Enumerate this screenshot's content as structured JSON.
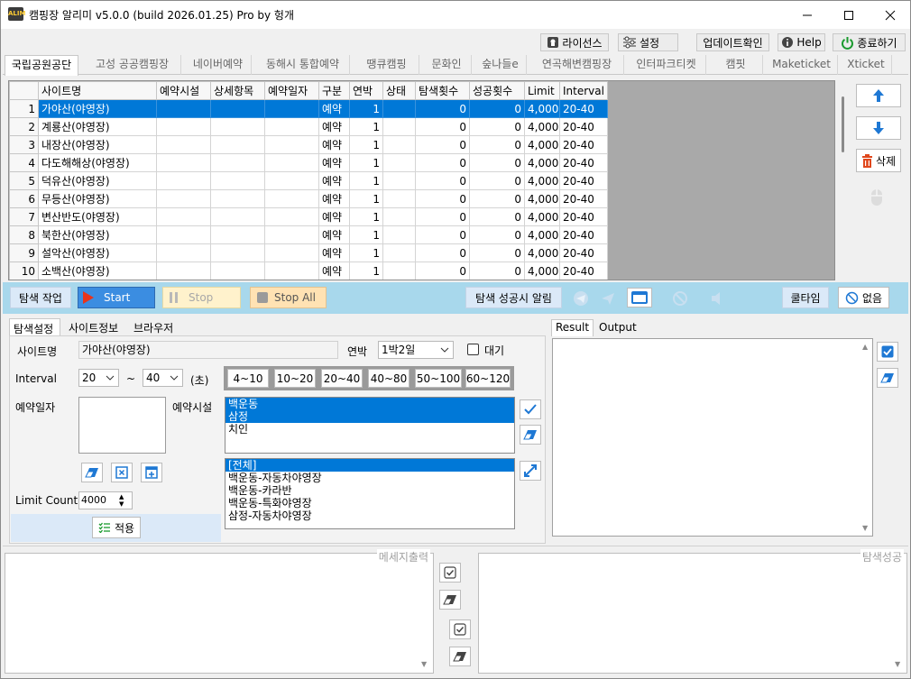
{
  "window": {
    "title": "캠핑장 알리미 v5.0.0 (build 2026.01.25) Pro by 헝개",
    "icon_text": "ALIM"
  },
  "toolbar": {
    "license": "라이선스",
    "settings": "설정",
    "update": "업데이트확인",
    "help": "Help",
    "exit": "종료하기"
  },
  "tabs": [
    "국립공원공단",
    "고성 공공캠핑장",
    "네이버예약",
    "동해시 통합예약",
    "땡큐캠핑",
    "문화인",
    "숲나들e",
    "연곡해변캠핑장",
    "인터파크티켓",
    "캠핏",
    "Maketicket",
    "Xticket"
  ],
  "grid": {
    "columns": [
      "사이트명",
      "예약시설",
      "상세항목",
      "예약일자",
      "구분",
      "연박",
      "상태",
      "탐색횟수",
      "성공횟수",
      "Limit",
      "Interval"
    ],
    "rows": [
      {
        "no": "1",
        "site": "가야산(야영장)",
        "facility": "",
        "detail": "",
        "date": "",
        "type": "예약",
        "nights": "1",
        "status": "",
        "search": "0",
        "success": "0",
        "limit": "4,000",
        "interval": "20-40"
      },
      {
        "no": "2",
        "site": "계룡산(야영장)",
        "facility": "",
        "detail": "",
        "date": "",
        "type": "예약",
        "nights": "1",
        "status": "",
        "search": "0",
        "success": "0",
        "limit": "4,000",
        "interval": "20-40"
      },
      {
        "no": "3",
        "site": "내장산(야영장)",
        "facility": "",
        "detail": "",
        "date": "",
        "type": "예약",
        "nights": "1",
        "status": "",
        "search": "0",
        "success": "0",
        "limit": "4,000",
        "interval": "20-40"
      },
      {
        "no": "4",
        "site": "다도해해상(야영장)",
        "facility": "",
        "detail": "",
        "date": "",
        "type": "예약",
        "nights": "1",
        "status": "",
        "search": "0",
        "success": "0",
        "limit": "4,000",
        "interval": "20-40"
      },
      {
        "no": "5",
        "site": "덕유산(야영장)",
        "facility": "",
        "detail": "",
        "date": "",
        "type": "예약",
        "nights": "1",
        "status": "",
        "search": "0",
        "success": "0",
        "limit": "4,000",
        "interval": "20-40"
      },
      {
        "no": "6",
        "site": "무등산(야영장)",
        "facility": "",
        "detail": "",
        "date": "",
        "type": "예약",
        "nights": "1",
        "status": "",
        "search": "0",
        "success": "0",
        "limit": "4,000",
        "interval": "20-40"
      },
      {
        "no": "7",
        "site": "변산반도(야영장)",
        "facility": "",
        "detail": "",
        "date": "",
        "type": "예약",
        "nights": "1",
        "status": "",
        "search": "0",
        "success": "0",
        "limit": "4,000",
        "interval": "20-40"
      },
      {
        "no": "8",
        "site": "북한산(야영장)",
        "facility": "",
        "detail": "",
        "date": "",
        "type": "예약",
        "nights": "1",
        "status": "",
        "search": "0",
        "success": "0",
        "limit": "4,000",
        "interval": "20-40"
      },
      {
        "no": "9",
        "site": "설악산(야영장)",
        "facility": "",
        "detail": "",
        "date": "",
        "type": "예약",
        "nights": "1",
        "status": "",
        "search": "0",
        "success": "0",
        "limit": "4,000",
        "interval": "20-40"
      },
      {
        "no": "10",
        "site": "소백산(야영장)",
        "facility": "",
        "detail": "",
        "date": "",
        "type": "예약",
        "nights": "1",
        "status": "",
        "search": "0",
        "success": "0",
        "limit": "4,000",
        "interval": "20-40"
      }
    ]
  },
  "side": {
    "delete": "삭제"
  },
  "control": {
    "search_work": "탐색 작업",
    "start": "Start",
    "stop": "Stop",
    "stop_all": "Stop All",
    "success_alert": "탐색 성공시 알림",
    "cooltime": "쿨타임",
    "none": "없음"
  },
  "subtabs": [
    "탐색설정",
    "사이트정보",
    "브라우저"
  ],
  "settings": {
    "site_label": "사이트명",
    "site_value": "가야산(야영장)",
    "nights_label": "연박",
    "nights_value": "1박2일",
    "wait_label": "대기",
    "interval_label": "Interval",
    "interval_min": "20",
    "interval_sep": "~",
    "interval_max": "40",
    "interval_unit": "(초)",
    "ranges": [
      "4~10",
      "10~20",
      "20~40",
      "40~80",
      "50~100",
      "60~120"
    ],
    "date_label": "예약일자",
    "facility_label": "예약시설",
    "facilities": [
      {
        "name": "백운동",
        "selected": true
      },
      {
        "name": "삼정",
        "selected": true
      },
      {
        "name": "치인",
        "selected": false
      }
    ],
    "details": [
      {
        "name": "[전체]",
        "selected": true
      },
      {
        "name": "백운동-자동차야영장",
        "selected": false
      },
      {
        "name": "백운동-카라반",
        "selected": false
      },
      {
        "name": "백운동-특화야영장",
        "selected": false
      },
      {
        "name": "삼정-자동차야영장",
        "selected": false
      }
    ],
    "limit_label": "Limit Count",
    "limit_value": "4000",
    "apply": "적용"
  },
  "result_tabs": [
    "Result",
    "Output"
  ],
  "bottom": {
    "message_label": "메세지출력",
    "success_label": "탐색성공"
  },
  "colors": {
    "accent": "#0078d7",
    "control_bar": "#a8d8ec",
    "start": "#3b8de1"
  }
}
